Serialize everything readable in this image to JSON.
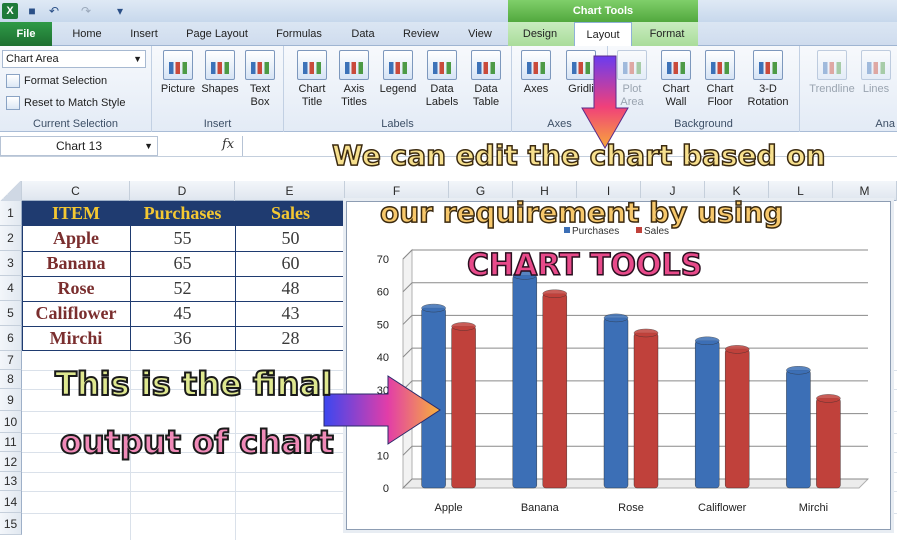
{
  "quick_access": [
    "excel-logo",
    "save-icon",
    "undo-icon",
    "redo-icon",
    "customize-icon"
  ],
  "title_bar": {
    "chart_tools": "Chart Tools"
  },
  "tabs": {
    "file": "File",
    "home": "Home",
    "insert": "Insert",
    "page_layout": "Page Layout",
    "formulas": "Formulas",
    "data": "Data",
    "review": "Review",
    "view": "View",
    "design": "Design",
    "layout": "Layout",
    "format": "Format"
  },
  "ribbon": {
    "current_selection": {
      "dropdown": "Chart Area",
      "format_selection": "Format Selection",
      "reset": "Reset to Match Style",
      "label": "Current Selection"
    },
    "insert_group": {
      "picture": "Picture",
      "shapes": "Shapes",
      "text_box_1": "Text",
      "text_box_2": "Box",
      "label": "Insert"
    },
    "labels_group": {
      "chart_title_1": "Chart",
      "chart_title_2": "Title",
      "axis_titles_1": "Axis",
      "axis_titles_2": "Titles",
      "legend": "Legend",
      "data_labels_1": "Data",
      "data_labels_2": "Labels",
      "data_table_1": "Data",
      "data_table_2": "Table",
      "label": "Labels"
    },
    "axes_group": {
      "axes": "Axes",
      "gridlines": "Gridli",
      "label": "Axes"
    },
    "background_group": {
      "plot_area_1": "Plot",
      "plot_area_2": "Area",
      "chart_wall_1": "Chart",
      "chart_wall_2": "Wall",
      "chart_floor_1": "Chart",
      "chart_floor_2": "Floor",
      "rotation_1": "3-D",
      "rotation_2": "Rotation",
      "label": "Background"
    },
    "analysis_group": {
      "trendline": "Trendline",
      "lines": "Lines",
      "label": "Ana"
    }
  },
  "formula_bar": {
    "name_box": "Chart 13",
    "fx": "fx"
  },
  "columns": [
    "C",
    "D",
    "E",
    "F",
    "G",
    "H",
    "I",
    "J",
    "K",
    "L",
    "M"
  ],
  "rows": [
    "1",
    "2",
    "3",
    "4",
    "5",
    "6",
    "7",
    "8",
    "9",
    "10",
    "11",
    "12",
    "13",
    "14",
    "15"
  ],
  "table": {
    "headers": [
      "ITEM",
      "Purchases",
      "Sales"
    ],
    "rows": [
      [
        "Apple",
        "55",
        "50"
      ],
      [
        "Banana",
        "65",
        "60"
      ],
      [
        "Rose",
        "52",
        "48"
      ],
      [
        "Califlower",
        "45",
        "43"
      ],
      [
        "Mirchi",
        "36",
        "28"
      ]
    ]
  },
  "chart_data": {
    "type": "bar",
    "categories": [
      "Apple",
      "Banana",
      "Rose",
      "Califlower",
      "Mirchi"
    ],
    "series": [
      {
        "name": "Purchases",
        "values": [
          55,
          65,
          52,
          45,
          36
        ],
        "color": "#3c6fb6"
      },
      {
        "name": "Sales",
        "values": [
          50,
          60,
          48,
          43,
          28
        ],
        "color": "#c0413b"
      }
    ],
    "ylim": [
      0,
      70
    ],
    "yticks": [
      "0",
      "10",
      "20",
      "30",
      "40",
      "50",
      "60",
      "70"
    ],
    "legend": "top",
    "grid": true
  },
  "annotations": {
    "line1": "We can edit the chart based on",
    "line2": "our requirement by using",
    "line3": "CHART TOOLS",
    "line4": "This is the final",
    "line5": "output of chart"
  }
}
